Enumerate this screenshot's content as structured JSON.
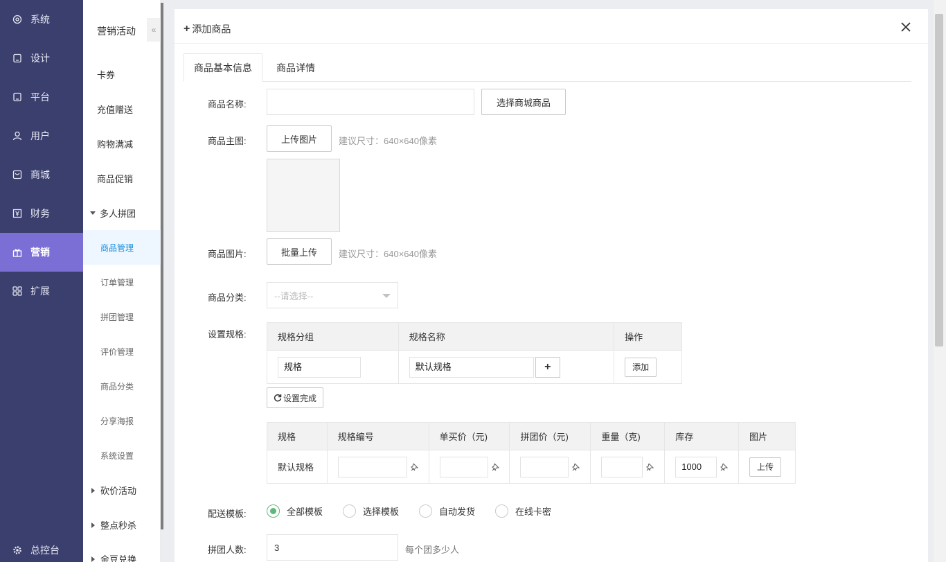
{
  "nav": {
    "items": [
      {
        "label": "系统",
        "icon": "gear-icon"
      },
      {
        "label": "设计",
        "icon": "tablet-icon"
      },
      {
        "label": "平台",
        "icon": "tablet-icon"
      },
      {
        "label": "用户",
        "icon": "user-icon"
      },
      {
        "label": "商城",
        "icon": "shop-icon"
      },
      {
        "label": "财务",
        "icon": "yen-icon"
      },
      {
        "label": "营销",
        "icon": "gift-icon"
      },
      {
        "label": "扩展",
        "icon": "grid-icon"
      }
    ],
    "active": "营销",
    "bottom": "总控台"
  },
  "subnav": {
    "title": "营销活动",
    "collapse_glyph": "«",
    "items": [
      "卡券",
      "充值赠送",
      "购物满减",
      "商品促销"
    ],
    "group_open": "多人拼团",
    "group_children": [
      "商品管理",
      "订单管理",
      "拼团管理",
      "评价管理",
      "商品分类",
      "分享海报",
      "系统设置"
    ],
    "active_child": "商品管理",
    "groups_closed": [
      "砍价活动",
      "整点秒杀",
      "金豆兑换"
    ]
  },
  "modal": {
    "title": "添加商品",
    "tabs": [
      "商品基本信息",
      "商品详情"
    ],
    "active_tab": "商品基本信息",
    "form": {
      "name_label": "商品名称:",
      "name_value": "",
      "choose_btn": "选择商城商品",
      "main_img_label": "商品主图:",
      "upload_btn": "上传图片",
      "size_hint": "建议尺寸：640×640像素",
      "gallery_label": "商品图片:",
      "batch_upload_btn": "批量上传",
      "category_label": "商品分类:",
      "category_placeholder": "--请选择--",
      "spec_label": "设置规格:",
      "spec_table": {
        "headers": [
          "规格分组",
          "规格名称",
          "操作"
        ],
        "group_value": "规格",
        "name_value": "默认规格",
        "add_btn": "添加"
      },
      "spec_done_btn": "设置完成",
      "sku_table": {
        "headers": [
          "规格",
          "规格编号",
          "单买价（元)",
          "拼团价（元)",
          "重量（克)",
          "库存",
          "图片"
        ],
        "row": {
          "spec": "默认规格",
          "code": "",
          "price": "",
          "group_price": "",
          "weight": "",
          "stock": "1000",
          "upload": "上传"
        }
      },
      "delivery_label": "配送模板:",
      "delivery_options": [
        "全部模板",
        "选择模板",
        "自动发货",
        "在线卡密"
      ],
      "delivery_selected": "全部模板",
      "group_size_label": "拼团人数:",
      "group_size_value": "3",
      "group_size_hint": "每个团多少人"
    }
  }
}
